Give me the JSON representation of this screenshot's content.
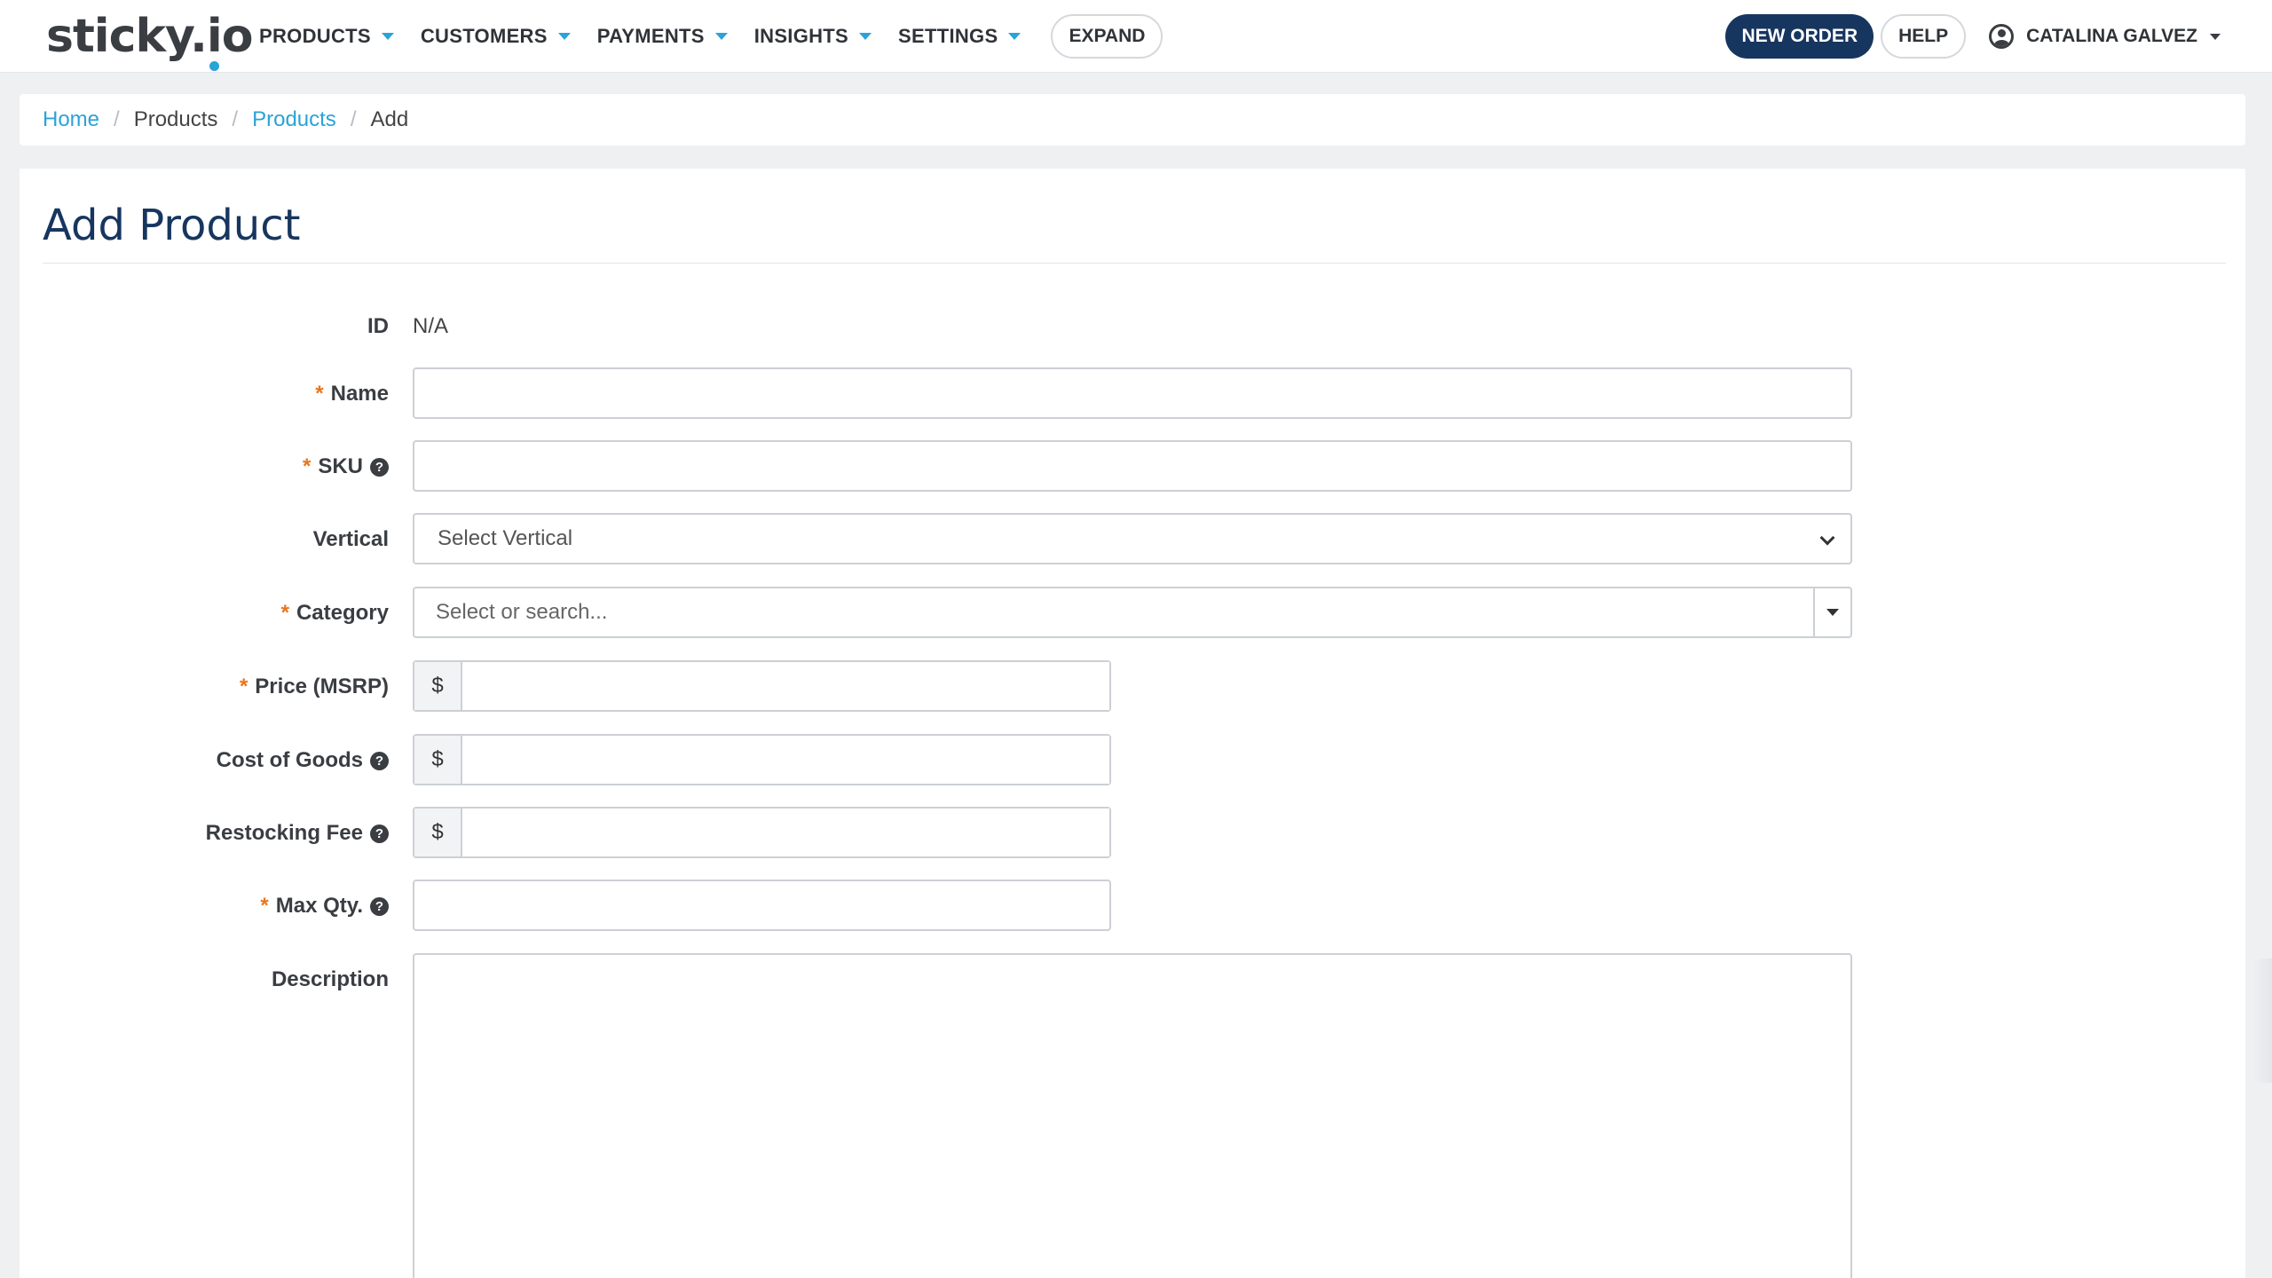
{
  "app": {
    "logo_text": "sticky.io"
  },
  "nav": {
    "items": [
      {
        "label": "PRODUCTS"
      },
      {
        "label": "CUSTOMERS"
      },
      {
        "label": "PAYMENTS"
      },
      {
        "label": "INSIGHTS"
      },
      {
        "label": "SETTINGS"
      }
    ],
    "expand_label": "EXPAND",
    "new_order_label": "NEW ORDER",
    "help_label": "HELP",
    "user_name": "CATALINA GALVEZ"
  },
  "breadcrumb": {
    "items": [
      "Home",
      "Products",
      "Products",
      "Add"
    ],
    "separator": "/"
  },
  "page": {
    "title": "Add Product"
  },
  "form": {
    "id": {
      "label": "ID",
      "value": "N/A"
    },
    "name": {
      "label": "Name",
      "value": "",
      "required_mark": "*"
    },
    "sku": {
      "label": "SKU",
      "value": "",
      "required_mark": "*"
    },
    "vertical": {
      "label": "Vertical",
      "selected": "Select Vertical"
    },
    "category": {
      "label": "Category",
      "placeholder": "Select or search...",
      "required_mark": "*"
    },
    "price": {
      "label": "Price (MSRP)",
      "currency": "$",
      "value": "",
      "required_mark": "*"
    },
    "cost_of_goods": {
      "label": "Cost of Goods",
      "currency": "$",
      "value": ""
    },
    "restocking_fee": {
      "label": "Restocking Fee",
      "currency": "$",
      "value": ""
    },
    "max_qty": {
      "label": "Max Qty.",
      "value": "",
      "required_mark": "*"
    },
    "description": {
      "label": "Description",
      "value": ""
    },
    "help_glyph": "?"
  },
  "colors": {
    "accent": "#2aa3d8",
    "primary_dark": "#17365f",
    "required": "#e8761c"
  },
  "icons": {
    "help": "question-circle-icon",
    "user": "user-circle-icon",
    "dropdown": "caret-down-icon"
  }
}
